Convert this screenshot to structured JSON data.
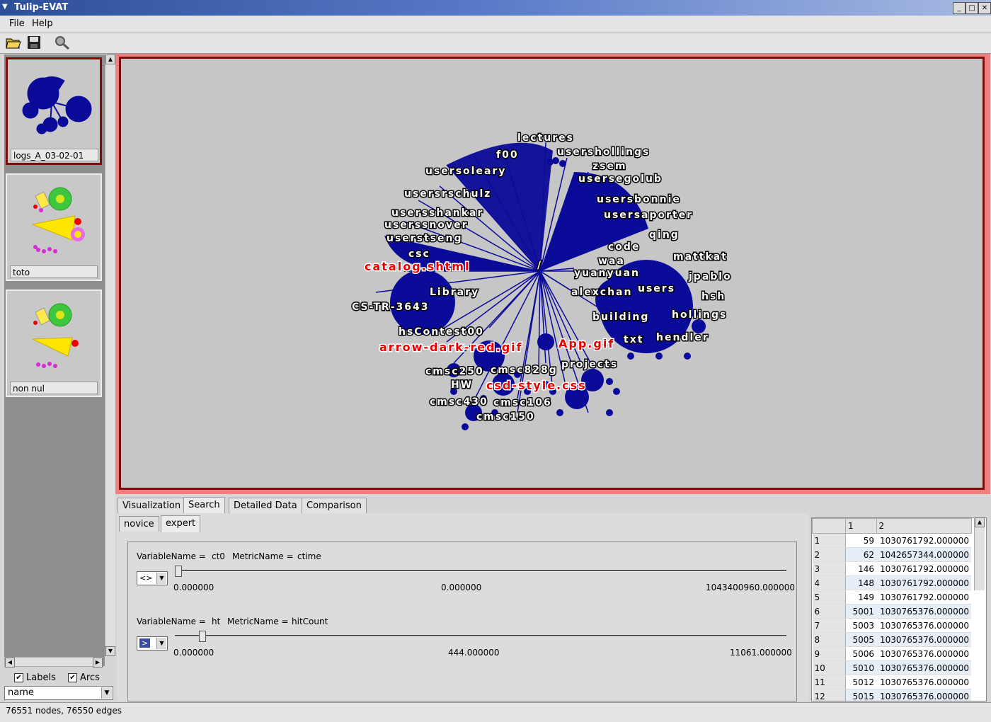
{
  "window": {
    "title": "Tulip-EVAT"
  },
  "menu": {
    "file": "File",
    "help": "Help"
  },
  "toolbar": {
    "open_icon": "folder-open-icon",
    "save_icon": "save-icon",
    "search_icon": "magnifier-icon"
  },
  "views": [
    {
      "label": "logs_A_03-02-01"
    },
    {
      "label": "toto"
    },
    {
      "label": "non nul"
    }
  ],
  "options": {
    "labels": "Labels",
    "arcs": "Arcs",
    "labels_checked": true,
    "arcs_checked": true,
    "property": "name"
  },
  "colors": {
    "node": "#0b0b99",
    "canvas_bg": "#c6c6c6",
    "border": "#7b0d0d",
    "highlight": "#e00000"
  },
  "graph_labels": [
    {
      "text": "lectures",
      "highlighted": false
    },
    {
      "text": "f00",
      "highlighted": false
    },
    {
      "text": "usershollings",
      "highlighted": false
    },
    {
      "text": "zsem",
      "highlighted": false
    },
    {
      "text": "usersoleary",
      "highlighted": false
    },
    {
      "text": "usersegolub",
      "highlighted": false
    },
    {
      "text": "usersrschulz",
      "highlighted": false
    },
    {
      "text": "usersbonnie",
      "highlighted": false
    },
    {
      "text": "usersshankar",
      "highlighted": false
    },
    {
      "text": "usersaporter",
      "highlighted": false
    },
    {
      "text": "userssnover",
      "highlighted": false
    },
    {
      "text": "userstseng",
      "highlighted": false
    },
    {
      "text": "qing",
      "highlighted": false
    },
    {
      "text": "code",
      "highlighted": false
    },
    {
      "text": "mattkat",
      "highlighted": false
    },
    {
      "text": "csc",
      "highlighted": false
    },
    {
      "text": "waa",
      "highlighted": false
    },
    {
      "text": "catalog.shtml",
      "highlighted": true
    },
    {
      "text": "/",
      "highlighted": false
    },
    {
      "text": "yuanyuan",
      "highlighted": false
    },
    {
      "text": "jpablo",
      "highlighted": false
    },
    {
      "text": "Library",
      "highlighted": false
    },
    {
      "text": "alexchan",
      "highlighted": false
    },
    {
      "text": "users",
      "highlighted": false
    },
    {
      "text": "hsh",
      "highlighted": false
    },
    {
      "text": "CS-TR-3643",
      "highlighted": false
    },
    {
      "text": "building",
      "highlighted": false
    },
    {
      "text": "hollings",
      "highlighted": false
    },
    {
      "text": "hsContest00",
      "highlighted": false
    },
    {
      "text": "txt",
      "highlighted": false
    },
    {
      "text": "hendler",
      "highlighted": false
    },
    {
      "text": "arrow-dark-red.gif",
      "highlighted": true
    },
    {
      "text": "App.gif",
      "highlighted": true
    },
    {
      "text": "projects",
      "highlighted": false
    },
    {
      "text": "cmsc250",
      "highlighted": false
    },
    {
      "text": "cmsc828g",
      "highlighted": false
    },
    {
      "text": "HW",
      "highlighted": false
    },
    {
      "text": "csd-style.css",
      "highlighted": true
    },
    {
      "text": "cmsc430",
      "highlighted": false
    },
    {
      "text": "cmsc106",
      "highlighted": false
    },
    {
      "text": "cmsc150",
      "highlighted": false
    }
  ],
  "tabs": [
    {
      "label": "Visualization"
    },
    {
      "label": "Search"
    },
    {
      "label": "Detailed Data"
    },
    {
      "label": "Comparison"
    }
  ],
  "subtabs": [
    {
      "label": "novice"
    },
    {
      "label": "expert"
    }
  ],
  "expert": {
    "filters": [
      {
        "variable_label": "VariableName =",
        "variable": "ct0",
        "metric_label": "MetricName =",
        "metric": "ctime",
        "operator": "<>",
        "min": "0.000000",
        "value": "0.000000",
        "max": "1043400960.000000",
        "position": 0.0
      },
      {
        "variable_label": "VariableName =",
        "variable": "ht",
        "metric_label": "MetricName =",
        "metric": "hitCount",
        "operator": ">",
        "min": "0.000000",
        "value": "444.000000",
        "max": "11061.000000",
        "position": 0.04
      }
    ]
  },
  "table": {
    "headers": [
      "1",
      "2"
    ],
    "rows": [
      {
        "n": "1",
        "a": "59",
        "b": "1030761792.000000"
      },
      {
        "n": "2",
        "a": "62",
        "b": "1042657344.000000"
      },
      {
        "n": "3",
        "a": "146",
        "b": "1030761792.000000"
      },
      {
        "n": "4",
        "a": "148",
        "b": "1030761792.000000"
      },
      {
        "n": "5",
        "a": "149",
        "b": "1030761792.000000"
      },
      {
        "n": "6",
        "a": "5001",
        "b": "1030765376.000000"
      },
      {
        "n": "7",
        "a": "5003",
        "b": "1030765376.000000"
      },
      {
        "n": "8",
        "a": "5005",
        "b": "1030765376.000000"
      },
      {
        "n": "9",
        "a": "5006",
        "b": "1030765376.000000"
      },
      {
        "n": "10",
        "a": "5010",
        "b": "1030765376.000000"
      },
      {
        "n": "11",
        "a": "5012",
        "b": "1030765376.000000"
      },
      {
        "n": "12",
        "a": "5015",
        "b": "1030765376.000000"
      }
    ]
  },
  "status": {
    "text": "76551 nodes, 76550 edges"
  }
}
